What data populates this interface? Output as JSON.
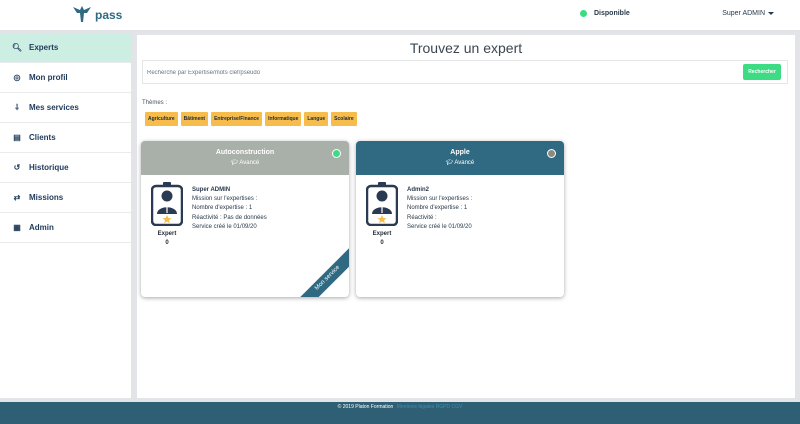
{
  "header": {
    "app_name": "pass",
    "logo_icon": "winged-logo-icon",
    "status_text": "Disponible",
    "status_color": "#3ddc84",
    "user_menu_label": "Super ADMIN"
  },
  "sidebar": {
    "accent_color": "#cdeee3",
    "items": [
      {
        "label": "Experts",
        "icon": "search-icon",
        "glyph": "🔍︎",
        "active": true
      },
      {
        "label": "Mon profil",
        "icon": "user-circle-icon",
        "glyph": "◎",
        "active": false
      },
      {
        "label": "Mes services",
        "icon": "plug-icon",
        "glyph": "⸸",
        "active": false
      },
      {
        "label": "Clients",
        "icon": "id-card-icon",
        "glyph": "▤",
        "active": false
      },
      {
        "label": "Historique",
        "icon": "history-icon",
        "glyph": "↺",
        "active": false
      },
      {
        "label": "Missions",
        "icon": "exchange-icon",
        "glyph": "⇄",
        "active": false
      },
      {
        "label": "Admin",
        "icon": "admin-card-icon",
        "glyph": "▦",
        "active": false
      }
    ]
  },
  "main": {
    "title": "Trouvez un expert",
    "search": {
      "placeholder": "Recherche par Expertise/mots clef/pseudo",
      "value": "",
      "button_label": "Rechercher",
      "button_color": "#3ddc84"
    },
    "themes_label": "Thèmes :",
    "tag_color": "#f6bd4c",
    "tags": [
      "Agriculture",
      "Bâtiment",
      "Entreprise/Finance",
      "Informatique",
      "Langue",
      "Scolaire"
    ],
    "cards": [
      {
        "title": "Autoconstruction",
        "level": "Avancé",
        "header_color": "#a9afa9",
        "status_color": "#3ddc84",
        "name": "Super ADMIN",
        "line1": "Mission sur l'expertises :",
        "line2": "Nombre d'expertise : 1",
        "line3": "Réactivité : Pas de données",
        "line4": "Service créé le 01/09/20",
        "expert_label": "Expert",
        "expert_count": "0",
        "ribbon": "Mon service"
      },
      {
        "title": "Apple",
        "level": "Avancé",
        "header_color": "#2f6a82",
        "status_color": "#8a8a82",
        "name": "Admin2",
        "line1": "Mission sur l'expertises :",
        "line2": "Nombre d'expertise : 1",
        "line3": "Réactivité :",
        "line4": "Service créé le 01/09/20",
        "expert_label": "Expert",
        "expert_count": "0"
      }
    ]
  },
  "footer": {
    "copyright": "© 2019 Platon Formation",
    "links": "Mentions légales RGPD CGV",
    "color": "#2f5f75"
  }
}
